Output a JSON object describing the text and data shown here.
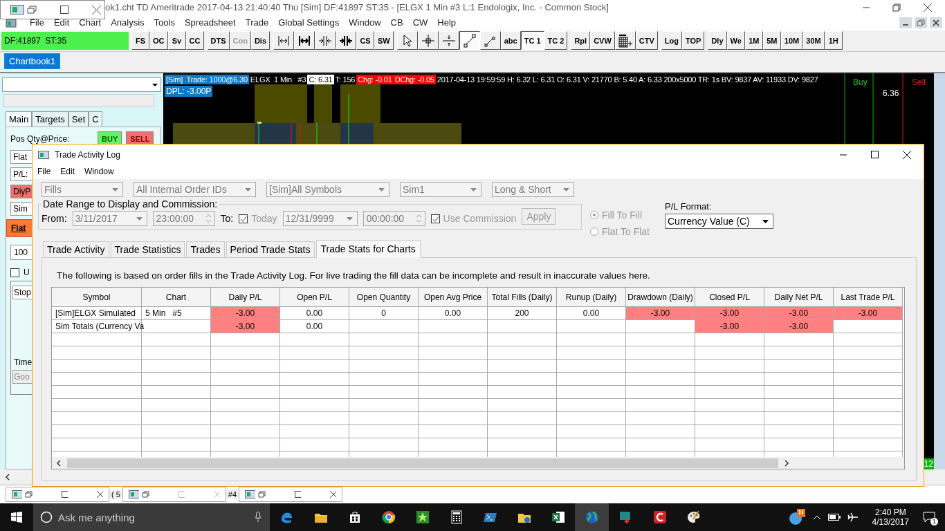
{
  "app": {
    "title": "ok1.cht  TD Ameritrade 2017-04-13  21:40:40 Thu [Sim]  DF:41897  ST:35 - [ELGX  1 Min   #3  L:1  Endologix, Inc. - Common Stock]",
    "menu": [
      "File",
      "Edit",
      "Chart",
      "Analysis",
      "Tools",
      "Spreadsheet",
      "Trade",
      "Global Settings",
      "Window",
      "CB",
      "CW",
      "Help"
    ],
    "status": "DF:41897  ST:35",
    "toolbar": [
      [
        {
          "kind": "text",
          "label": "FS",
          "selected": false,
          "disabled": false
        },
        {
          "kind": "text",
          "label": "OC",
          "selected": false,
          "disabled": false
        },
        {
          "kind": "text",
          "label": "Sv",
          "selected": false,
          "disabled": false
        },
        {
          "kind": "text",
          "label": "CC",
          "selected": false,
          "disabled": false
        }
      ],
      [
        {
          "kind": "text",
          "label": "DTS",
          "selected": false,
          "disabled": false
        },
        {
          "kind": "text",
          "label": "Con",
          "selected": false,
          "disabled": true
        },
        {
          "kind": "text",
          "label": "Dis",
          "selected": false,
          "disabled": false
        }
      ],
      [
        {
          "kind": "icon",
          "selected": false,
          "disabled": false
        },
        {
          "kind": "icon",
          "selected": false,
          "disabled": false
        },
        {
          "kind": "icon",
          "selected": false,
          "disabled": false
        },
        {
          "kind": "icon",
          "selected": false,
          "disabled": false
        },
        {
          "kind": "text",
          "label": "CS",
          "selected": false,
          "disabled": false
        },
        {
          "kind": "text",
          "label": "SW",
          "selected": false,
          "disabled": false
        }
      ],
      [
        {
          "kind": "icon",
          "selected": false,
          "disabled": false
        },
        {
          "kind": "icon",
          "selected": false,
          "disabled": false
        },
        {
          "kind": "icon",
          "selected": false,
          "disabled": false
        },
        {
          "kind": "icon",
          "selected": true,
          "disabled": false
        },
        {
          "kind": "icon",
          "selected": false,
          "disabled": false
        },
        {
          "kind": "text",
          "label": "abc",
          "selected": false,
          "disabled": false
        },
        {
          "kind": "text",
          "label": "TC 1",
          "selected": true,
          "disabled": false
        },
        {
          "kind": "text",
          "label": "TC 2",
          "selected": false,
          "disabled": false
        }
      ],
      [
        {
          "kind": "text",
          "label": "Rpl",
          "selected": false,
          "disabled": false
        },
        {
          "kind": "text",
          "label": "CVW",
          "selected": false,
          "disabled": false
        },
        {
          "kind": "icon",
          "selected": false,
          "disabled": false
        },
        {
          "kind": "text",
          "label": "CTV",
          "selected": false,
          "disabled": false
        }
      ],
      [
        {
          "kind": "text",
          "label": "Log",
          "selected": false,
          "disabled": false
        },
        {
          "kind": "text",
          "label": "TOP",
          "selected": false,
          "disabled": false
        }
      ],
      [
        {
          "kind": "text",
          "label": "Dly",
          "selected": false,
          "disabled": false
        },
        {
          "kind": "text",
          "label": "We",
          "selected": false,
          "disabled": false
        },
        {
          "kind": "text",
          "label": "1M",
          "selected": false,
          "disabled": false
        },
        {
          "kind": "text",
          "label": "5M",
          "selected": false,
          "disabled": false
        },
        {
          "kind": "text",
          "label": "10M",
          "selected": false,
          "disabled": false
        },
        {
          "kind": "text",
          "label": "30M",
          "selected": false,
          "disabled": false
        },
        {
          "kind": "text",
          "label": "1H",
          "selected": false,
          "disabled": false
        }
      ]
    ],
    "chartbook_tabs": [
      {
        "label": "Chartbook1",
        "selected": true
      }
    ]
  },
  "left_panel": {
    "tabs": [
      {
        "label": "Main",
        "selected": true
      },
      {
        "label": "Targets",
        "selected": false
      },
      {
        "label": "Set",
        "selected": false
      },
      {
        "label": "C",
        "selected": false
      }
    ],
    "pos_label": "Pos Qty@Price:",
    "buy": "BUY",
    "sell": "SELL",
    "position": "Flat",
    "pl": "P/L:",
    "daily_pl": "DlyP",
    "account": "Sim",
    "flatten": "Flat",
    "quantity": "100",
    "option": {
      "label": "U",
      "checked": false
    },
    "order_type": "Stop",
    "time_label": "Time",
    "time_in_force": "Goo"
  },
  "chart": {
    "header": [
      {
        "text": "[Sim]  Trade: 1000@6.30",
        "color": "#0c7ac8"
      },
      {
        "text": "ELGX  1 Min   #3",
        "color": "#000000"
      },
      {
        "text": "C: 6.31",
        "color": "#ffffff"
      },
      {
        "text": "T: 156",
        "color": "#000000"
      },
      {
        "text": "Chg: -0.01",
        "color": "#ff0000"
      },
      {
        "text": "DChg: -0.05",
        "color": "#ff0000"
      },
      {
        "text": "2017-04-13 19:59:59 H: 6.32 L: 6.31 O: 6.31 V: 21770 B: 5.40 A: 6.33 200x5000 TR: 1s BV: 9837 AV: 11933 DV: 9827",
        "color": "#000000"
      }
    ],
    "dpl": "DPL: -3.00P",
    "buy": "Buy",
    "sell": "Sell",
    "price": "6.36",
    "badge": "12"
  },
  "dialog": {
    "title": "Trade Activity Log",
    "menu": [
      "File",
      "Edit",
      "Window"
    ],
    "filters": [
      {
        "value": "Fills",
        "disabled": true
      },
      {
        "value": "All Internal Order IDs",
        "disabled": true
      },
      {
        "value": "[Sim]All Symbols",
        "disabled": true
      },
      {
        "value": "Sim1",
        "disabled": true
      },
      {
        "value": "Long & Short",
        "disabled": true
      }
    ],
    "date_range": {
      "legend": "Date Range to Display and Commission:",
      "from_label": "From:",
      "from_date": "3/11/2017",
      "from_time": "23:00:00",
      "to_label": "To:",
      "today": {
        "label": "Today",
        "checked": true
      },
      "to_date": "12/31/9999",
      "to_time": "00:00:00",
      "commission": {
        "label": "Use Commission",
        "checked": true
      },
      "apply": "Apply",
      "disabled": true
    },
    "pairing": [
      {
        "label": "Fill To Fill",
        "selected": true
      },
      {
        "label": "Flat To Flat",
        "selected": false
      }
    ],
    "pl_format": {
      "label": "P/L Format:",
      "value": "Currency Value (C)"
    },
    "tabs": [
      {
        "label": "Trade Activity",
        "selected": false
      },
      {
        "label": "Trade Statistics",
        "selected": false
      },
      {
        "label": "Trades",
        "selected": false
      },
      {
        "label": "Period Trade Stats",
        "selected": false
      },
      {
        "label": "Trade Stats for Charts",
        "selected": true
      }
    ],
    "note": "The following is based on order fills in the Trade Activity Log. For live trading the fill data can be incomplete and result in inaccurate values here.",
    "table": {
      "columns": [
        "Symbol",
        "Chart",
        "Daily P/L",
        "Open P/L",
        "Open Quantity",
        "Open Avg Price",
        "Total Fills (Daily)",
        "Runup (Daily)",
        "Drawdown (Daily)",
        "Closed P/L",
        "Daily Net P/L",
        "Last Trade P/L"
      ],
      "rows": [
        [
          {
            "text": "[Sim]ELGX Simulated",
            "alert": false
          },
          {
            "text": "5 Min   #5",
            "alert": false
          },
          {
            "text": "-3.00",
            "alert": true
          },
          {
            "text": "0.00",
            "alert": false
          },
          {
            "text": "0",
            "alert": false
          },
          {
            "text": "0.00",
            "alert": false
          },
          {
            "text": "200",
            "alert": false
          },
          {
            "text": "0.00",
            "alert": false
          },
          {
            "text": "-3.00",
            "alert": true
          },
          {
            "text": "-3.00",
            "alert": true
          },
          {
            "text": "-3.00",
            "alert": true
          },
          {
            "text": "-3.00",
            "alert": true
          }
        ],
        [
          {
            "text": "Sim Totals (Currency Va",
            "alert": false
          },
          {
            "alert": false
          },
          {
            "text": "-3.00",
            "alert": true
          },
          {
            "text": "0.00",
            "alert": false
          },
          {
            "alert": false
          },
          {
            "alert": false
          },
          {
            "alert": false
          },
          {
            "alert": false
          },
          {
            "alert": false
          },
          {
            "text": "-3.00",
            "alert": true
          },
          {
            "text": "-3.00",
            "alert": true
          },
          {
            "alert": false
          }
        ]
      ]
    }
  },
  "minimized_tails": [
    "( 5",
    "#4"
  ],
  "taskbar": {
    "search": "Ask me anything",
    "apps": [
      {
        "selected": false
      },
      {
        "selected": false
      },
      {
        "selected": false
      },
      {
        "selected": false
      },
      {
        "selected": false
      },
      {
        "selected": false
      },
      {
        "selected": false
      },
      {
        "selected": false
      },
      {
        "selected": false
      },
      {
        "selected": true
      },
      {
        "selected": false
      },
      {
        "selected": false
      },
      {
        "selected": false
      }
    ],
    "time": "2:40 PM",
    "date": "4/13/2017",
    "notifications": "1"
  }
}
